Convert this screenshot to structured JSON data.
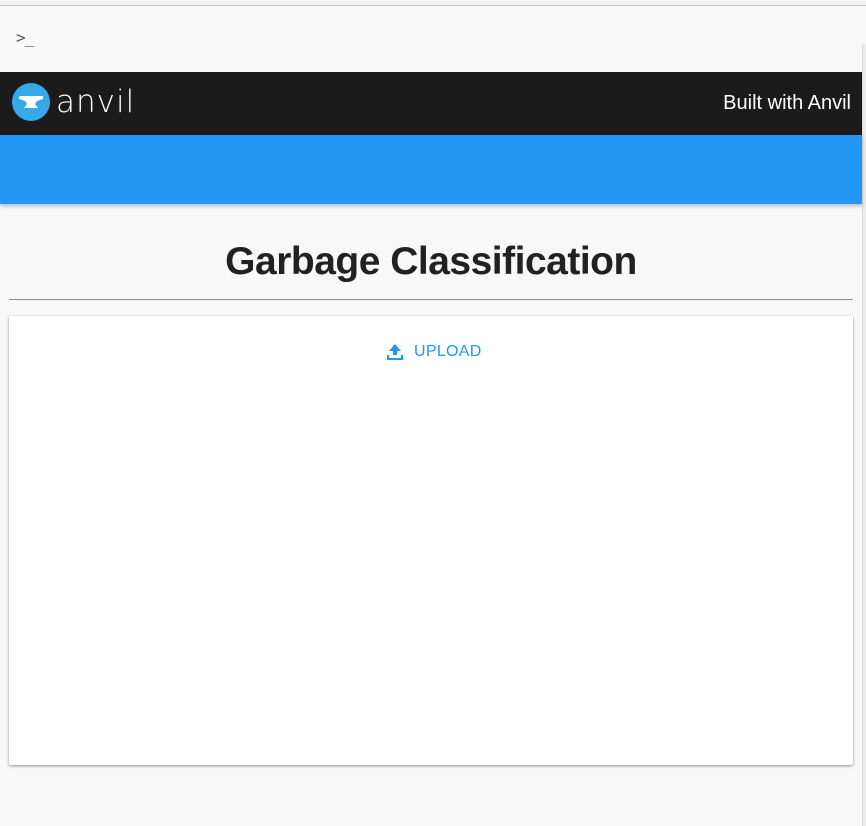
{
  "console": {
    "prompt": ">_"
  },
  "header": {
    "logo_text": "anvil",
    "built_with": "Built with Anvil",
    "bar_color": "#1b1b1b",
    "logo_color": "#36a9e8"
  },
  "banner": {
    "color": "#2196f3"
  },
  "main": {
    "title": "Garbage Classification"
  },
  "card": {
    "upload_label": "UPLOAD",
    "upload_icon": "upload-icon",
    "accent_color": "#2196f3"
  }
}
